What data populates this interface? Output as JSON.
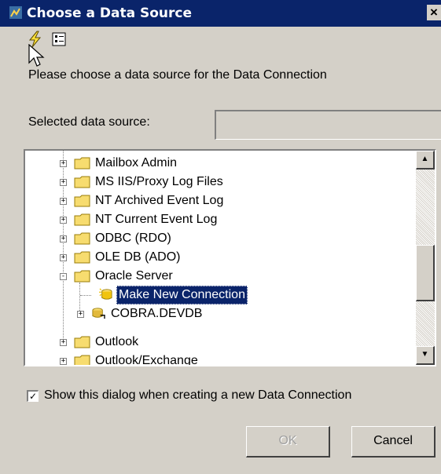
{
  "window": {
    "title": "Choose a Data Source",
    "close_glyph": "×",
    "icon": "app-icon"
  },
  "toolbar": {
    "items": [
      {
        "icon": "lightning-icon"
      },
      {
        "icon": "properties-icon"
      }
    ]
  },
  "prompt": "Please choose a data source for the Data Connection",
  "selected_source": {
    "label": "Selected data source:",
    "value": ""
  },
  "tree": {
    "items": [
      {
        "label": "Mailbox Admin",
        "icon": "folder-icon",
        "expander": "+"
      },
      {
        "label": "MS IIS/Proxy Log Files",
        "icon": "folder-icon",
        "expander": "+"
      },
      {
        "label": "NT Archived Event Log",
        "icon": "folder-icon",
        "expander": "+"
      },
      {
        "label": "NT Current Event Log",
        "icon": "folder-icon",
        "expander": "+"
      },
      {
        "label": "ODBC (RDO)",
        "icon": "folder-icon",
        "expander": "+"
      },
      {
        "label": "OLE DB (ADO)",
        "icon": "folder-icon",
        "expander": "+"
      },
      {
        "label": "Oracle Server",
        "icon": "folder-icon",
        "expander": "-"
      },
      {
        "label": "Make New Connection",
        "icon": "new-connection-icon",
        "expander": "",
        "selected": true
      },
      {
        "label": "COBRA.DEVDB",
        "icon": "database-icon",
        "expander": "+"
      },
      {
        "label": "Outlook",
        "icon": "folder-icon",
        "expander": "+"
      },
      {
        "label": "Outlook/Exchange",
        "icon": "folder-icon",
        "expander": "+"
      }
    ]
  },
  "show_dialog": {
    "label": "Show this dialog when creating a new Data Connection",
    "checked": true,
    "check_glyph": "✓"
  },
  "buttons": {
    "ok": "OK",
    "cancel": "Cancel"
  },
  "scrollbar": {
    "up_glyph": "▲",
    "down_glyph": "▼"
  },
  "colors": {
    "titlebar": "#0a246a",
    "selection": "#0a246a",
    "face": "#d4d0c8"
  }
}
